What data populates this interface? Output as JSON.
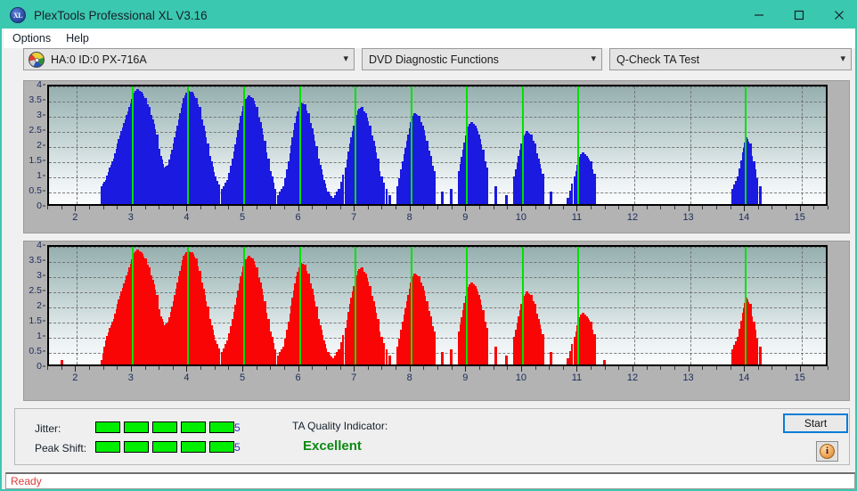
{
  "window": {
    "title": "PlexTools Professional XL V3.16",
    "icon": "XL",
    "app_icon_name": "plextools-logo-icon",
    "controls": {
      "minimize": "minimize-icon",
      "maximize": "maximize-icon",
      "close": "close-icon"
    },
    "titlebar_color": "#3bc8b0"
  },
  "menu": {
    "items": [
      {
        "label": "Options"
      },
      {
        "label": "Help"
      }
    ]
  },
  "toolbar": {
    "drive_select": {
      "value": "HA:0 ID:0  PX-716A",
      "icon": "disc-icon"
    },
    "function_select": {
      "value": "DVD Diagnostic Functions"
    },
    "test_select": {
      "value": "Q-Check TA Test"
    }
  },
  "charts": {
    "y_ticks": [
      "4",
      "3.5",
      "3",
      "2.5",
      "2",
      "1.5",
      "1",
      "0.5",
      "0"
    ],
    "x_ticks": [
      "2",
      "3",
      "4",
      "5",
      "6",
      "7",
      "8",
      "9",
      "10",
      "11",
      "12",
      "13",
      "14",
      "15"
    ],
    "marker_color": "#00e000",
    "jitter_color": "#1a1ae0",
    "peak_color": "#fa0505"
  },
  "chart_data": [
    {
      "type": "bar",
      "title": "Jitter",
      "xlabel": "",
      "ylabel": "",
      "xlim": [
        1.5,
        15.5
      ],
      "ylim": [
        0,
        4
      ],
      "ytick_values": [
        0,
        0.5,
        1,
        1.5,
        2,
        2.5,
        3,
        3.5,
        4
      ],
      "xtick_values": [
        2,
        3,
        4,
        5,
        6,
        7,
        8,
        9,
        10,
        11,
        12,
        13,
        14,
        15
      ],
      "grid": true,
      "series_color": "#1a1ae0",
      "markers": [
        3,
        4,
        5,
        6,
        7,
        8,
        9,
        10,
        11,
        14
      ],
      "x": [
        2.45,
        2.52,
        2.59,
        2.66,
        2.73,
        2.8,
        2.87,
        2.94,
        3.01,
        3.08,
        3.15,
        3.22,
        3.29,
        3.36,
        3.43,
        3.5,
        3.57,
        3.64,
        3.71,
        3.78,
        3.85,
        3.92,
        3.99,
        4.06,
        4.13,
        4.2,
        4.27,
        4.34,
        4.41,
        4.48,
        4.6,
        4.7,
        4.8,
        4.87,
        4.94,
        5.01,
        5.08,
        5.15,
        5.22,
        5.29,
        5.36,
        5.43,
        5.5,
        5.6,
        5.7,
        5.8,
        5.87,
        5.94,
        6.01,
        6.08,
        6.15,
        6.22,
        6.29,
        6.36,
        6.43,
        6.5,
        6.6,
        6.7,
        6.82,
        6.9,
        6.97,
        7.04,
        7.11,
        7.18,
        7.25,
        7.32,
        7.39,
        7.46,
        7.6,
        7.75,
        7.85,
        7.92,
        7.99,
        8.06,
        8.13,
        8.2,
        8.27,
        8.34,
        8.41,
        8.55,
        8.7,
        8.85,
        8.93,
        9.0,
        9.07,
        9.14,
        9.21,
        9.28,
        9.35,
        9.5,
        9.7,
        9.85,
        9.93,
        10.0,
        10.07,
        10.14,
        10.21,
        10.28,
        10.35,
        10.5,
        10.8,
        10.93,
        11.0,
        11.07,
        11.14,
        11.21,
        11.28,
        13.75,
        13.85,
        13.95,
        14.0,
        14.07,
        14.14,
        14.25
      ],
      "values": [
        0.6,
        0.8,
        1.2,
        1.5,
        2.0,
        2.4,
        2.8,
        3.2,
        3.6,
        3.8,
        3.7,
        3.5,
        3.2,
        2.8,
        2.3,
        1.6,
        1.2,
        1.3,
        1.8,
        2.4,
        3.0,
        3.5,
        3.75,
        3.7,
        3.5,
        3.2,
        2.6,
        2.0,
        1.4,
        0.9,
        0.5,
        0.8,
        1.5,
        2.2,
        2.9,
        3.4,
        3.6,
        3.5,
        3.2,
        2.7,
        2.1,
        1.5,
        0.9,
        0.3,
        0.6,
        1.4,
        2.2,
        2.9,
        3.35,
        3.3,
        3.0,
        2.5,
        1.9,
        1.3,
        0.8,
        0.4,
        0.2,
        0.5,
        1.2,
        2.0,
        2.6,
        3.1,
        3.2,
        3.0,
        2.6,
        2.1,
        1.5,
        0.9,
        0.3,
        0.6,
        1.4,
        2.1,
        2.7,
        3.0,
        2.9,
        2.6,
        2.1,
        1.6,
        1.1,
        0.4,
        0.5,
        1.1,
        1.8,
        2.5,
        2.7,
        2.6,
        2.3,
        1.8,
        1.2,
        0.6,
        0.3,
        0.9,
        1.6,
        2.2,
        2.4,
        2.3,
        2.0,
        1.5,
        1.0,
        0.4,
        0.2,
        0.9,
        1.5,
        1.7,
        1.6,
        1.4,
        1.0,
        0.5,
        0.9,
        1.7,
        2.2,
        2.0,
        1.4,
        0.6
      ]
    },
    {
      "type": "bar",
      "title": "Peak Shift",
      "xlabel": "",
      "ylabel": "",
      "xlim": [
        1.5,
        15.5
      ],
      "ylim": [
        0,
        4
      ],
      "ytick_values": [
        0,
        0.5,
        1,
        1.5,
        2,
        2.5,
        3,
        3.5,
        4
      ],
      "xtick_values": [
        2,
        3,
        4,
        5,
        6,
        7,
        8,
        9,
        10,
        11,
        12,
        13,
        14,
        15
      ],
      "grid": true,
      "series_color": "#fa0505",
      "markers": [
        3,
        4,
        5,
        6,
        7,
        8,
        9,
        10,
        11,
        14
      ],
      "x": [
        1.72,
        2.45,
        2.52,
        2.59,
        2.66,
        2.73,
        2.8,
        2.87,
        2.94,
        3.01,
        3.08,
        3.15,
        3.22,
        3.29,
        3.36,
        3.43,
        3.5,
        3.57,
        3.64,
        3.71,
        3.78,
        3.85,
        3.92,
        3.99,
        4.06,
        4.13,
        4.2,
        4.27,
        4.34,
        4.41,
        4.48,
        4.6,
        4.7,
        4.8,
        4.87,
        4.94,
        5.01,
        5.08,
        5.15,
        5.22,
        5.29,
        5.36,
        5.43,
        5.5,
        5.6,
        5.7,
        5.8,
        5.87,
        5.94,
        6.01,
        6.08,
        6.15,
        6.22,
        6.29,
        6.36,
        6.43,
        6.5,
        6.6,
        6.7,
        6.82,
        6.9,
        6.97,
        7.04,
        7.11,
        7.18,
        7.25,
        7.32,
        7.39,
        7.46,
        7.6,
        7.75,
        7.85,
        7.92,
        7.99,
        8.06,
        8.13,
        8.2,
        8.27,
        8.34,
        8.41,
        8.55,
        8.7,
        8.85,
        8.93,
        9.0,
        9.07,
        9.14,
        9.21,
        9.28,
        9.35,
        9.5,
        9.7,
        9.85,
        9.93,
        10.0,
        10.07,
        10.14,
        10.21,
        10.28,
        10.35,
        10.5,
        10.8,
        10.93,
        11.0,
        11.07,
        11.14,
        11.21,
        11.28,
        11.45,
        13.75,
        13.85,
        13.95,
        14.0,
        14.07,
        14.14,
        14.25
      ],
      "values": [
        0.15,
        0.15,
        0.8,
        1.2,
        1.5,
        2.0,
        2.4,
        2.8,
        3.2,
        3.6,
        3.8,
        3.7,
        3.5,
        3.2,
        2.8,
        2.3,
        1.6,
        1.3,
        1.4,
        1.9,
        2.5,
        3.1,
        3.6,
        3.75,
        3.7,
        3.5,
        3.1,
        2.5,
        1.9,
        1.3,
        0.8,
        0.4,
        0.8,
        1.5,
        2.2,
        2.9,
        3.4,
        3.6,
        3.5,
        3.2,
        2.7,
        2.1,
        1.5,
        0.9,
        0.3,
        0.6,
        1.4,
        2.2,
        2.9,
        3.35,
        3.3,
        3.0,
        2.5,
        1.9,
        1.3,
        0.8,
        0.4,
        0.2,
        0.5,
        1.2,
        2.0,
        2.6,
        3.1,
        3.2,
        3.0,
        2.6,
        2.1,
        1.5,
        0.9,
        0.3,
        0.6,
        1.4,
        2.1,
        2.7,
        3.0,
        2.9,
        2.6,
        2.1,
        1.6,
        1.1,
        0.4,
        0.5,
        1.1,
        1.8,
        2.5,
        2.7,
        2.6,
        2.3,
        1.8,
        1.2,
        0.6,
        0.3,
        0.9,
        1.6,
        2.2,
        2.4,
        2.3,
        2.0,
        1.5,
        1.0,
        0.4,
        0.2,
        0.9,
        1.5,
        1.7,
        1.6,
        1.4,
        1.0,
        0.15,
        0.5,
        0.9,
        1.7,
        2.2,
        2.0,
        1.4,
        0.6
      ]
    }
  ],
  "metrics": {
    "jitter": {
      "label": "Jitter:",
      "value": "5",
      "filled": 5,
      "total": 5
    },
    "peak_shift": {
      "label": "Peak Shift:",
      "value": "5",
      "filled": 5,
      "total": 5
    },
    "ta_quality": {
      "label": "TA Quality Indicator:",
      "value": "Excellent",
      "color": "#0a8a12"
    }
  },
  "actions": {
    "start_button": "Start",
    "info_button": "i"
  },
  "status": {
    "text": "Ready",
    "color": "#e03a3a"
  }
}
